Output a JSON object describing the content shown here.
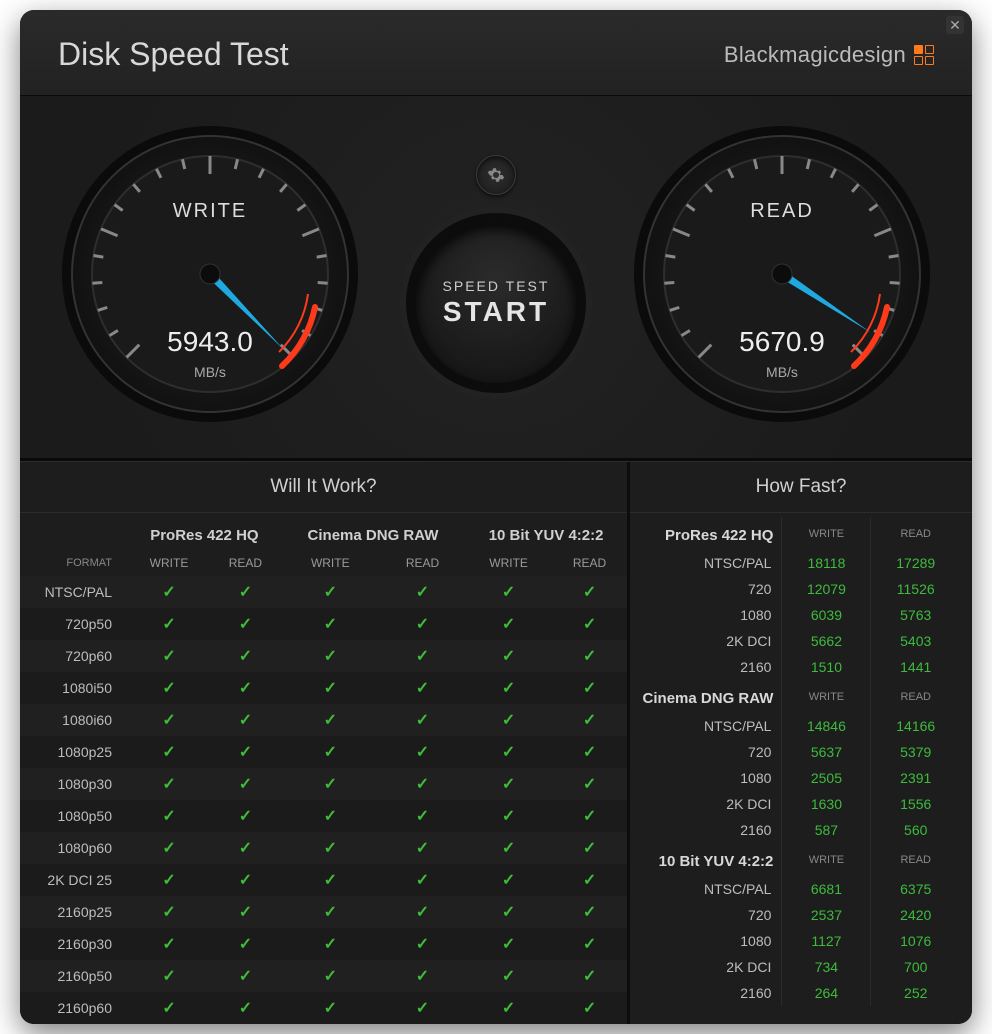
{
  "header": {
    "title": "Disk Speed Test",
    "brand": "Blackmagicdesign"
  },
  "gauges": {
    "write": {
      "label": "WRITE",
      "value": "5943.0",
      "unit": "MB/s",
      "angle": 130
    },
    "read": {
      "label": "READ",
      "value": "5670.9",
      "unit": "MB/s",
      "angle": 125
    }
  },
  "center": {
    "line1": "SPEED TEST",
    "line2": "START"
  },
  "willItWork": {
    "title": "Will It Work?",
    "formatHeader": "FORMAT",
    "codecs": [
      "ProRes 422 HQ",
      "Cinema DNG RAW",
      "10 Bit YUV 4:2:2"
    ],
    "subheads": [
      "WRITE",
      "READ"
    ],
    "rows": [
      {
        "fmt": "NTSC/PAL",
        "cells": [
          true,
          true,
          true,
          true,
          true,
          true
        ]
      },
      {
        "fmt": "720p50",
        "cells": [
          true,
          true,
          true,
          true,
          true,
          true
        ]
      },
      {
        "fmt": "720p60",
        "cells": [
          true,
          true,
          true,
          true,
          true,
          true
        ]
      },
      {
        "fmt": "1080i50",
        "cells": [
          true,
          true,
          true,
          true,
          true,
          true
        ]
      },
      {
        "fmt": "1080i60",
        "cells": [
          true,
          true,
          true,
          true,
          true,
          true
        ]
      },
      {
        "fmt": "1080p25",
        "cells": [
          true,
          true,
          true,
          true,
          true,
          true
        ]
      },
      {
        "fmt": "1080p30",
        "cells": [
          true,
          true,
          true,
          true,
          true,
          true
        ]
      },
      {
        "fmt": "1080p50",
        "cells": [
          true,
          true,
          true,
          true,
          true,
          true
        ]
      },
      {
        "fmt": "1080p60",
        "cells": [
          true,
          true,
          true,
          true,
          true,
          true
        ]
      },
      {
        "fmt": "2K DCI 25",
        "cells": [
          true,
          true,
          true,
          true,
          true,
          true
        ]
      },
      {
        "fmt": "2160p25",
        "cells": [
          true,
          true,
          true,
          true,
          true,
          true
        ]
      },
      {
        "fmt": "2160p30",
        "cells": [
          true,
          true,
          true,
          true,
          true,
          true
        ]
      },
      {
        "fmt": "2160p50",
        "cells": [
          true,
          true,
          true,
          true,
          true,
          true
        ]
      },
      {
        "fmt": "2160p60",
        "cells": [
          true,
          true,
          true,
          true,
          true,
          true
        ]
      }
    ]
  },
  "howFast": {
    "title": "How Fast?",
    "subheads": [
      "WRITE",
      "READ"
    ],
    "groups": [
      {
        "name": "ProRes 422 HQ",
        "rows": [
          {
            "lbl": "NTSC/PAL",
            "w": "18118",
            "r": "17289"
          },
          {
            "lbl": "720",
            "w": "12079",
            "r": "11526"
          },
          {
            "lbl": "1080",
            "w": "6039",
            "r": "5763"
          },
          {
            "lbl": "2K DCI",
            "w": "5662",
            "r": "5403"
          },
          {
            "lbl": "2160",
            "w": "1510",
            "r": "1441"
          }
        ]
      },
      {
        "name": "Cinema DNG RAW",
        "rows": [
          {
            "lbl": "NTSC/PAL",
            "w": "14846",
            "r": "14166"
          },
          {
            "lbl": "720",
            "w": "5637",
            "r": "5379"
          },
          {
            "lbl": "1080",
            "w": "2505",
            "r": "2391"
          },
          {
            "lbl": "2K DCI",
            "w": "1630",
            "r": "1556"
          },
          {
            "lbl": "2160",
            "w": "587",
            "r": "560"
          }
        ]
      },
      {
        "name": "10 Bit YUV 4:2:2",
        "rows": [
          {
            "lbl": "NTSC/PAL",
            "w": "6681",
            "r": "6375"
          },
          {
            "lbl": "720",
            "w": "2537",
            "r": "2420"
          },
          {
            "lbl": "1080",
            "w": "1127",
            "r": "1076"
          },
          {
            "lbl": "2K DCI",
            "w": "734",
            "r": "700"
          },
          {
            "lbl": "2160",
            "w": "264",
            "r": "252"
          }
        ]
      }
    ]
  }
}
